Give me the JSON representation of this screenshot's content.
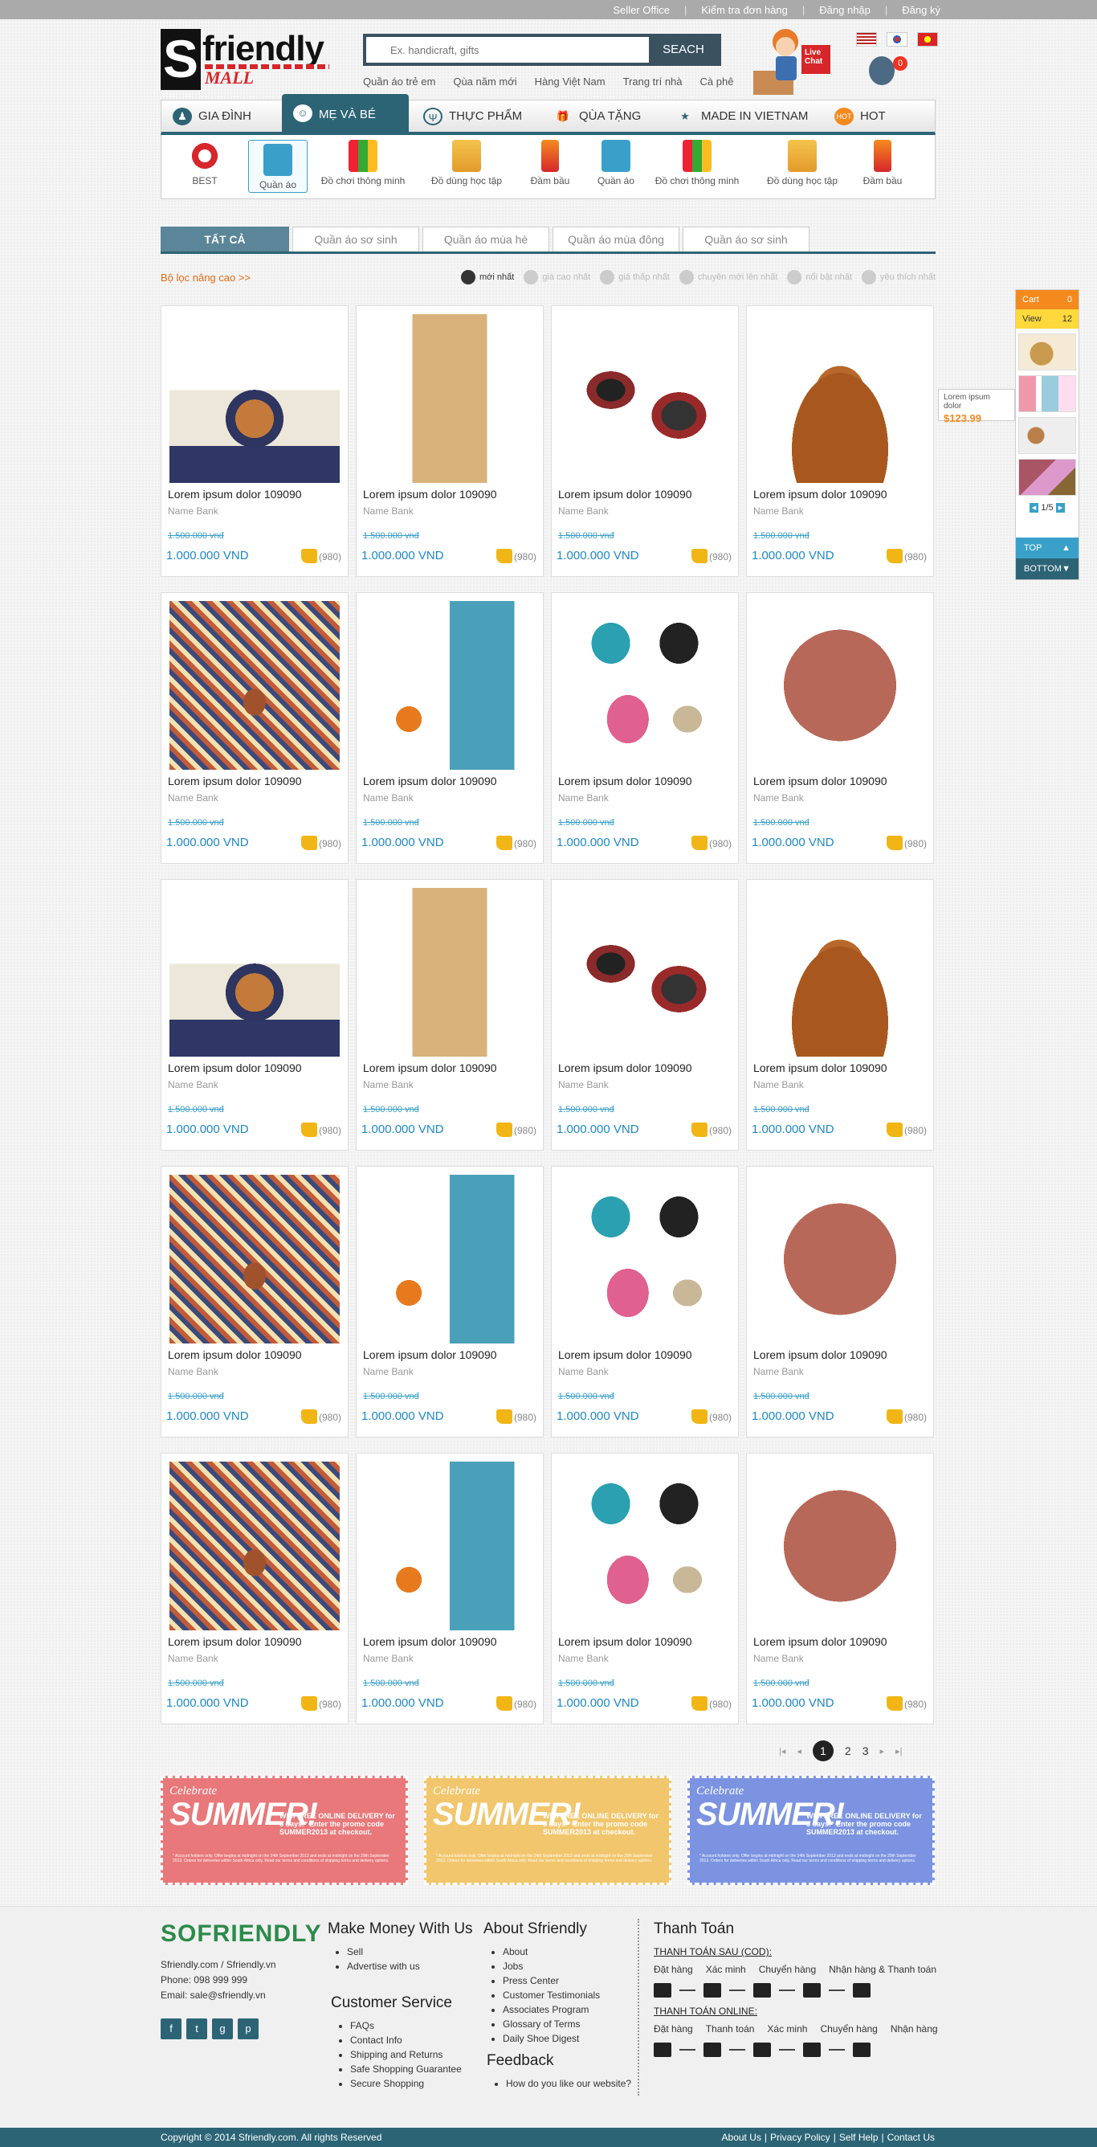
{
  "topbar": {
    "links": [
      "Seller Office",
      "Kiểm tra đơn hàng",
      "Đăng nhập",
      "Đăng ký"
    ]
  },
  "logo": {
    "letter": "S",
    "text": "friendly",
    "sub": "MALL"
  },
  "search": {
    "placeholder": "Ex. handicraft, gifts",
    "button": "SEACH"
  },
  "quick_links": [
    "Quần áo trẻ em",
    "Qùa năm mới",
    "Hàng Việt Nam",
    "Trang trí nhà",
    "Cà phê"
  ],
  "live_chat": "Live Chat",
  "cart_count": "0",
  "nav": [
    {
      "label": "Gia đình",
      "icon": "family-icon"
    },
    {
      "label": "Mẹ và bé",
      "icon": "mother-baby-icon"
    },
    {
      "label": "Thực phẩm",
      "icon": "food-icon"
    },
    {
      "label": "Qùa tặng",
      "icon": "gift-icon"
    },
    {
      "label": "Made in Vietnam",
      "icon": "star-icon"
    },
    {
      "label": "Hot",
      "icon": "hot-icon"
    }
  ],
  "subcats": [
    "BEST",
    "Quần áo",
    "Đồ chơi thông minh",
    "Đồ dùng học tập",
    "Đầm bầu",
    "Quần áo",
    "Đồ chơi thông minh",
    "Đồ dùng học tập",
    "Đầm bầu"
  ],
  "tabs": [
    "TẤT CẢ",
    "Quần áo sơ sinh",
    "Quần áo mùa hè",
    "Quần áo mùa đông",
    "Quần áo sơ sinh"
  ],
  "advanced_filter": "Bộ lọc nâng cao  >>",
  "sorts": [
    "mới nhất",
    "giá cao nhất",
    "giá thấp nhất",
    "chuyên mới lên nhất",
    "nổi bật nhất",
    "yêu thích nhất"
  ],
  "product": {
    "name": "Lorem ipsum dolor 109090",
    "bank": "Name Bank",
    "old_price": "1.500.000 vnđ",
    "price": "1.000.000 VND",
    "likes": "(980)"
  },
  "side": {
    "cart_label": "Cart",
    "cart_count": "0",
    "view_label": "View",
    "view_count": "12",
    "pager": "1/5",
    "top": "TOP",
    "bottom": "BOTTOM"
  },
  "tooltip": {
    "name": "Lorem ipsum dolor",
    "price": "$123.99"
  },
  "pagination": [
    "1",
    "2",
    "3"
  ],
  "banner": {
    "celebrate": "Celebrate",
    "summer": "SUMMER!",
    "offer": "With FREE ONLINE DELIVERY for 5 days!* Enter the promo code SUMMER2013 at checkout.",
    "fine": "* Account holders only. Offer begins at midnight on the 24th September 2013 and ends at midnight on the 29th September 2013. Orders for deliveries within South Africa only. Read our terms and conditions of shipping terms and delivery options."
  },
  "footer": {
    "logo": "SOFRIENDLY",
    "info": [
      "Sfriendly.com / Sfriendly.vn",
      "Phone: 098 999 999",
      "Email: sale@sfriendly.vn"
    ],
    "social": [
      "f",
      "t",
      "g",
      "p"
    ],
    "make_money": {
      "title": "Make Money With Us",
      "items": [
        "Sell",
        "Advertise with us"
      ]
    },
    "customer_service": {
      "title": "Customer Service",
      "items": [
        "FAQs",
        "Contact Info",
        "Shipping and Returns",
        "Safe Shopping Guarantee",
        "Secure Shopping"
      ]
    },
    "about": {
      "title": "About Sfriendly",
      "items": [
        "About",
        "Jobs",
        "Press Center",
        "Customer Testimonials",
        "Associates Program",
        "Glossary of Terms",
        "Daily Shoe Digest"
      ]
    },
    "feedback": {
      "title": "Feedback",
      "items": [
        "How do you like our website?"
      ]
    },
    "payment": {
      "title": "Thanh Toán",
      "cod_title": "THANH TOÁN SAU (COD):",
      "cod_steps": [
        "Đặt hàng",
        "Xác minh",
        "Chuyển hàng",
        "Nhận hàng & Thanh toán"
      ],
      "online_title": "THANH TOÁN ONLINE:",
      "online_steps": [
        "Đặt hàng",
        "Thanh toán",
        "Xác minh",
        "Chuyển hàng",
        "Nhận hàng"
      ]
    }
  },
  "copyright": "Copyright © 2014 Sfriendly.com. All rights Reserved",
  "bottom_links": [
    "About Us",
    "Privacy Policy",
    "Self Help",
    "Contact Us"
  ],
  "colors": {
    "accent": "#2c6476",
    "link_blue": "#1e88c8",
    "orange": "#f48a1e",
    "banner_red": "#e8787a",
    "banner_yellow": "#f1c66c",
    "banner_blue": "#7b93e0"
  }
}
